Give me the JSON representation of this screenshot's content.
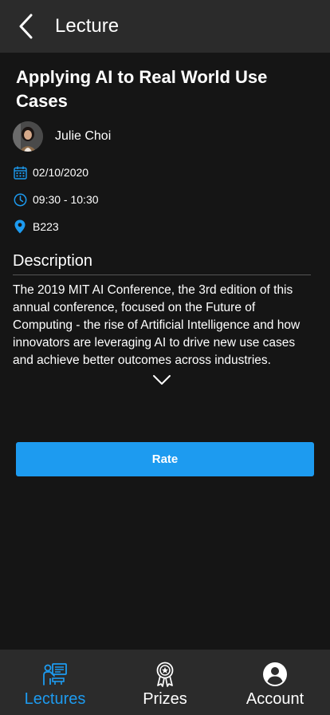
{
  "header": {
    "title": "Lecture",
    "back_icon": "chevron-left-icon"
  },
  "lecture": {
    "title": "Applying AI to Real World Use Cases",
    "speaker": "Julie Choi",
    "date": "02/10/2020",
    "time": "09:30 - 10:30",
    "room": "B223"
  },
  "description": {
    "heading": "Description",
    "text": "The 2019 MIT AI Conference, the 3rd edition of this annual conference, focused on the Future of Computing - the rise of Artificial Intelligence and how innovators are leveraging AI to drive new use cases and achieve better outcomes across industries."
  },
  "actions": {
    "rate_label": "Rate"
  },
  "nav": {
    "items": [
      {
        "label": "Lectures",
        "icon": "lecture-presenter-icon",
        "active": true
      },
      {
        "label": "Prizes",
        "icon": "award-medal-icon",
        "active": false
      },
      {
        "label": "Account",
        "icon": "account-circle-icon",
        "active": false
      }
    ]
  },
  "colors": {
    "accent": "#1d9bf0",
    "header_bg": "#2b2b2b",
    "page_bg": "#151515"
  }
}
